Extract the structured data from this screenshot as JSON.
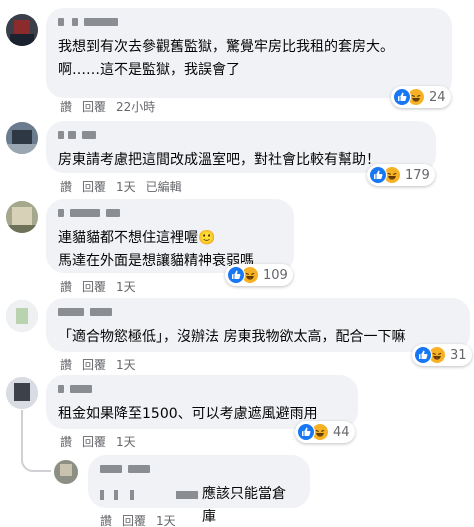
{
  "reply_label": "讚",
  "respond_label": "回覆",
  "comments": [
    {
      "text": "我想到有次去參觀舊監獄，驚覺牢房比我租的套房大。\n啊……這不是監獄，我誤會了",
      "time": "22小時",
      "edited": "",
      "reactions": "24"
    },
    {
      "text": "房東請考慮把這間改成溫室吧，對社會比較有幫助！",
      "time": "1天",
      "edited": "已編輯",
      "reactions": "179"
    },
    {
      "text": "連貓貓都不想住這裡喔🙂\n馬達在外面是想讓貓精神衰弱嗎",
      "time": "1天",
      "edited": "",
      "reactions": "109"
    },
    {
      "text": "「適合物慾極低」，沒辦法 房東我物欲太高，配合一下嘛",
      "time": "1天",
      "edited": "",
      "reactions": "31"
    },
    {
      "text": "租金如果降至1500、可以考慮遮風避雨用",
      "time": "1天",
      "edited": "",
      "reactions": "44"
    },
    {
      "text": "應該只能當倉庫",
      "time": "1天",
      "edited": "",
      "reactions": ""
    }
  ],
  "icons": {
    "like": "like-reaction-icon",
    "haha": "haha-reaction-icon"
  },
  "colors": {
    "bubble": "#f0f2f5",
    "meta": "#65676b",
    "like": "#1877f2",
    "haha": "#f7b125"
  }
}
